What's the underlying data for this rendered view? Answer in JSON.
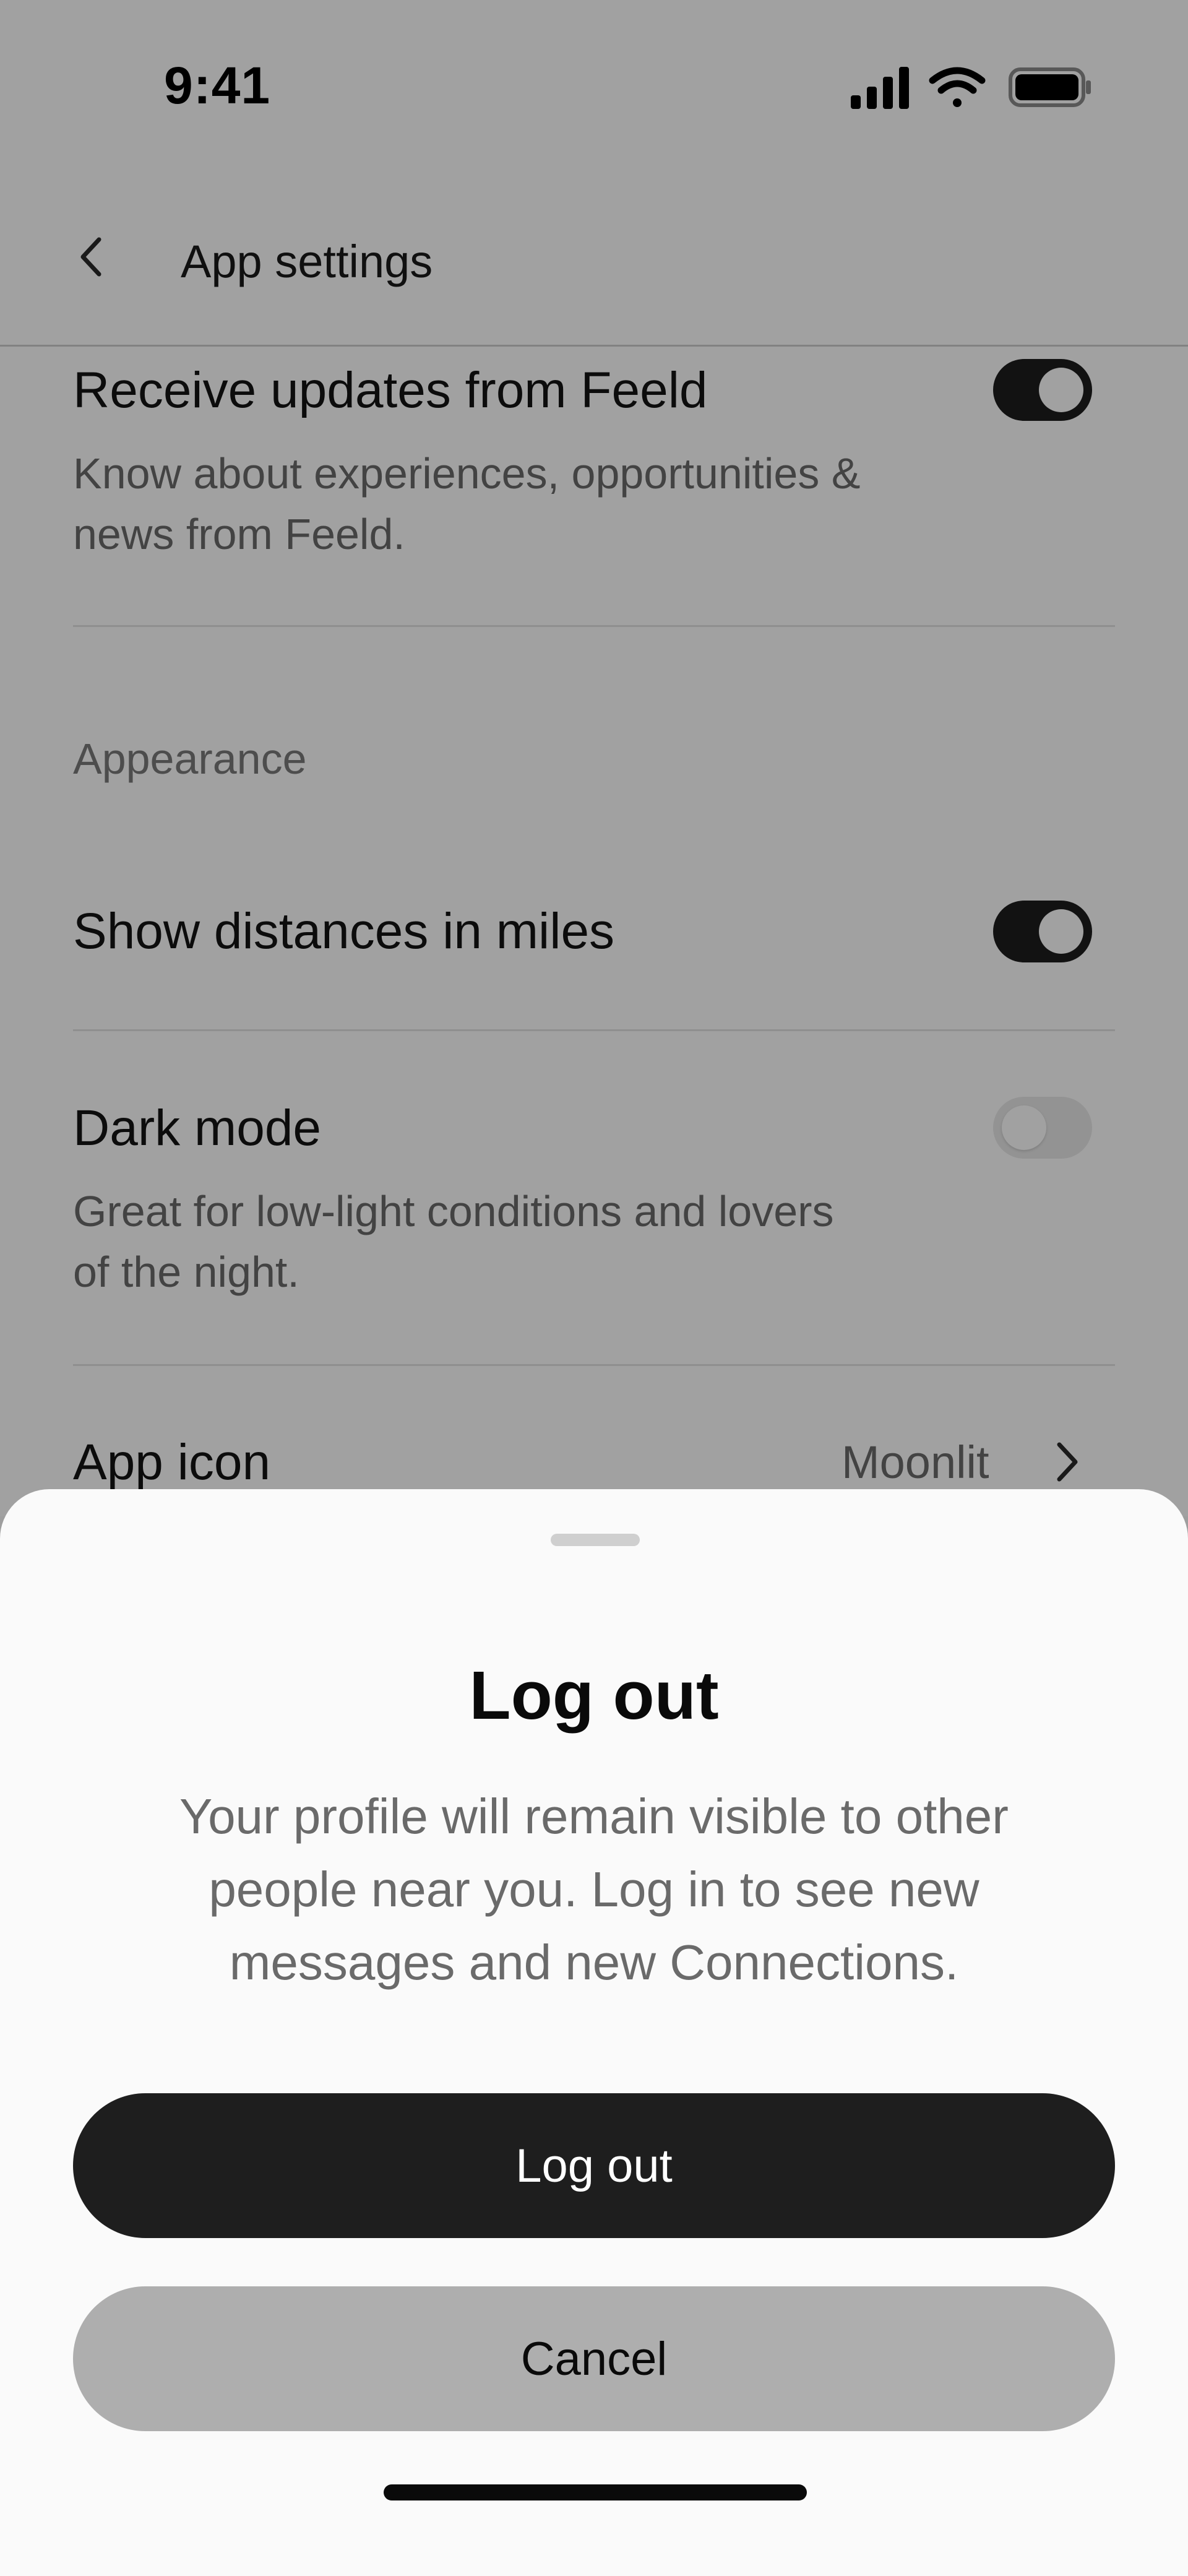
{
  "status_bar": {
    "time": "9:41"
  },
  "nav": {
    "title": "App settings"
  },
  "settings": {
    "updates": {
      "title": "Receive updates from Feeld",
      "description": "Know about experiences, opportunities & news from Feeld.",
      "enabled": true
    },
    "appearance_label": "Appearance",
    "miles": {
      "title": "Show distances in miles",
      "enabled": true
    },
    "dark_mode": {
      "title": "Dark mode",
      "description": "Great for low-light conditions and lovers of the night.",
      "enabled": false
    },
    "app_icon": {
      "title": "App icon",
      "value": "Moonlit"
    }
  },
  "sheet": {
    "title": "Log out",
    "message": "Your profile will remain visible to other people near you. Log in to see new messages and new Connections.",
    "primary_label": "Log out",
    "secondary_label": "Cancel"
  },
  "colors": {
    "toggle_on": "#1e1e1e",
    "primary_button": "#1e1e1e",
    "secondary_button": "#aeaeae",
    "sheet_background": "#fafafa"
  }
}
